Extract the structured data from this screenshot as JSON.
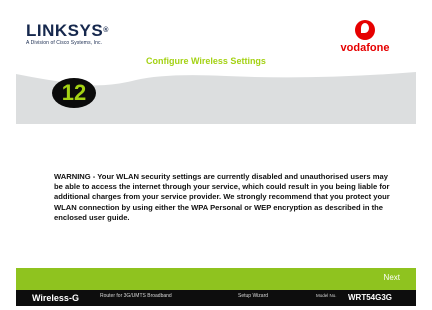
{
  "header": {
    "logo_text": "LINKSYS",
    "logo_reg": "®",
    "logo_subtitle": "A Division of Cisco Systems, Inc.",
    "partner": "vodafone",
    "step_title": "Configure Wireless Settings"
  },
  "step": {
    "number": "12"
  },
  "main": {
    "warning": "WARNING - Your WLAN security settings are currently disabled and unauthorised users may be able to access the internet through your service, which could result in you being liable for additional charges from your service provider. We strongly recommend that you protect your WLAN connection by using either the WPA Personal or WEP encryption as described in the enclosed user guide."
  },
  "actions": {
    "next_label": "Next"
  },
  "footer": {
    "product": "Wireless-G",
    "description": "Router for 3G/UMTS Broadband",
    "wizard": "Setup Wizard",
    "model_label": "Model No.",
    "model": "WRT54G3G"
  },
  "colors": {
    "accent_green": "#8fc31f",
    "title_green": "#a4d214",
    "vodafone_red": "#e60000",
    "brand_navy": "#16284d",
    "footer_black": "#0d0d0d"
  }
}
